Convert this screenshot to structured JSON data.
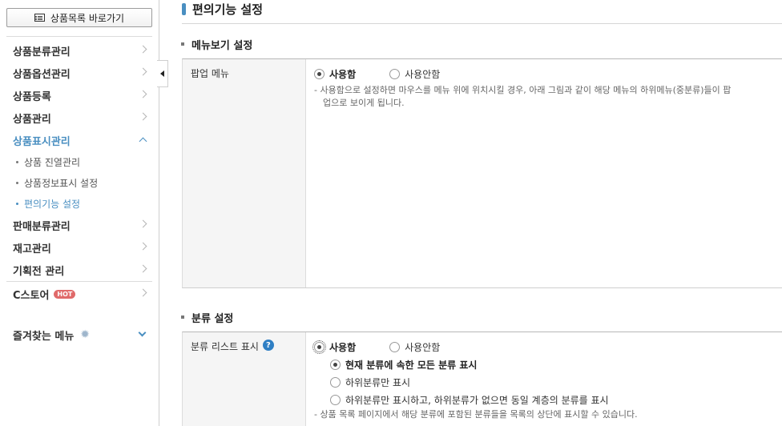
{
  "sidebar": {
    "list_button": "상품목록 바로가기",
    "menu": [
      {
        "label": "상품분류관리"
      },
      {
        "label": "상품옵션관리"
      },
      {
        "label": "상품등록"
      },
      {
        "label": "상품관리"
      },
      {
        "label": "상품표시관리",
        "active": true
      },
      {
        "label": "판매분류관리"
      },
      {
        "label": "재고관리"
      },
      {
        "label": "기획전 관리"
      },
      {
        "label": "C스토어",
        "badge": "HOT"
      }
    ],
    "submenu": [
      {
        "label": "상품 진열관리"
      },
      {
        "label": "상품정보표시 설정"
      },
      {
        "label": "편의기능 설정",
        "current": true
      }
    ],
    "favorites": "즐겨찾는 메뉴"
  },
  "page": {
    "title": "편의기능 설정"
  },
  "section_menu": {
    "title": "메뉴보기 설정",
    "row_label": "팝업 메뉴",
    "option_use": "사용함",
    "option_nouse": "사용안함",
    "note_line1": "- 사용함으로 설정하면 마우스를 메뉴 위에 위치시킬 경우, 아래 그림과 같이 해당 메뉴의 하위메뉴(중분류)들이 팝",
    "note_line2": "업으로 보이게 됩니다."
  },
  "section_category": {
    "title": "분류 설정",
    "row_label": "분류 리스트 표시",
    "help_icon": "?",
    "option_use": "사용함",
    "option_nouse": "사용안함",
    "sub_options": [
      {
        "label": "현재 분류에 속한 모든 분류 표시",
        "selected": true
      },
      {
        "label": "하위분류만 표시",
        "selected": false
      },
      {
        "label": "하위분류만 표시하고, 하위분류가 없으면 동일 계층의 분류를 표시",
        "selected": false
      }
    ],
    "note": "- 상품 목록 페이지에서 해당 분류에 포함된 분류들을 목록의 상단에 표시할 수 있습니다."
  },
  "colors": {
    "accent": "#4a8fc1",
    "hot_badge": "#e06a6a",
    "help_icon": "#2f7fc4"
  }
}
